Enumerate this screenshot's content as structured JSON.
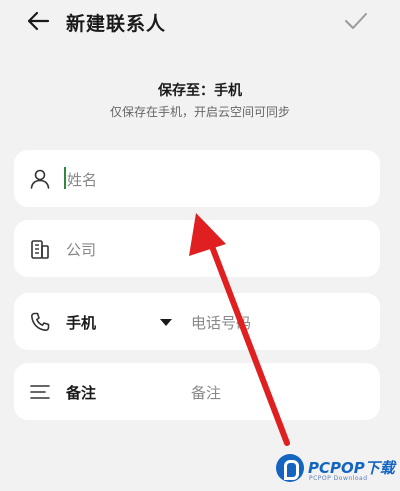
{
  "header": {
    "title": "新建联系人",
    "back_icon": "arrow-left-icon",
    "confirm_icon": "check-icon"
  },
  "save_info": {
    "save_to": "保存至：手机",
    "hint": "仅保存在手机，开启云空间可同步"
  },
  "fields": {
    "name": {
      "icon": "person-icon",
      "placeholder": "姓名"
    },
    "company": {
      "icon": "building-icon",
      "placeholder": "公司"
    },
    "phone": {
      "icon": "phone-icon",
      "type_label": "手机",
      "placeholder": "电话号码"
    },
    "note": {
      "icon": "menu-lines-icon",
      "label": "备注",
      "placeholder": "备注"
    }
  },
  "watermark": {
    "brand": "PCPOP下载",
    "sub": "PCPOP Download"
  },
  "colors": {
    "background": "#f2f2f3",
    "card": "#ffffff",
    "cursor": "#2e8b3c",
    "annotation_arrow": "#e02020",
    "logo": "#1565c0"
  }
}
